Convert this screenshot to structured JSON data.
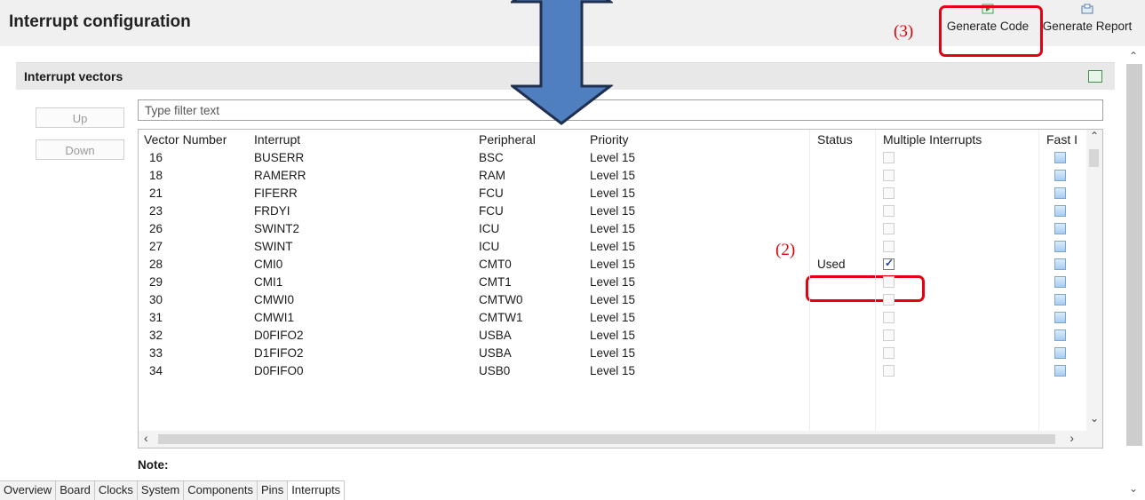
{
  "header": {
    "title": "Interrupt configuration",
    "generate_code": "Generate Code",
    "generate_report": "Generate Report"
  },
  "annotations": {
    "a3": "(3)",
    "a2": "(2)"
  },
  "section": {
    "title": "Interrupt vectors"
  },
  "buttons": {
    "up": "Up",
    "down": "Down"
  },
  "filter": {
    "placeholder": "Type filter text",
    "value": ""
  },
  "table": {
    "columns": [
      "Vector Number",
      "Interrupt",
      "Peripheral",
      "Priority",
      "Status",
      "Multiple Interrupts",
      "Fast I"
    ],
    "rows": [
      {
        "vector": "16",
        "interrupt": "BUSERR",
        "peripheral": "BSC",
        "priority": "Level 15",
        "status": "",
        "multiple": false
      },
      {
        "vector": "18",
        "interrupt": "RAMERR",
        "peripheral": "RAM",
        "priority": "Level 15",
        "status": "",
        "multiple": false
      },
      {
        "vector": "21",
        "interrupt": "FIFERR",
        "peripheral": "FCU",
        "priority": "Level 15",
        "status": "",
        "multiple": false
      },
      {
        "vector": "23",
        "interrupt": "FRDYI",
        "peripheral": "FCU",
        "priority": "Level 15",
        "status": "",
        "multiple": false
      },
      {
        "vector": "26",
        "interrupt": "SWINT2",
        "peripheral": "ICU",
        "priority": "Level 15",
        "status": "",
        "multiple": false
      },
      {
        "vector": "27",
        "interrupt": "SWINT",
        "peripheral": "ICU",
        "priority": "Level 15",
        "status": "",
        "multiple": false
      },
      {
        "vector": "28",
        "interrupt": "CMI0",
        "peripheral": "CMT0",
        "priority": "Level 15",
        "status": "Used",
        "multiple": true
      },
      {
        "vector": "29",
        "interrupt": "CMI1",
        "peripheral": "CMT1",
        "priority": "Level 15",
        "status": "",
        "multiple": false
      },
      {
        "vector": "30",
        "interrupt": "CMWI0",
        "peripheral": "CMTW0",
        "priority": "Level 15",
        "status": "",
        "multiple": false
      },
      {
        "vector": "31",
        "interrupt": "CMWI1",
        "peripheral": "CMTW1",
        "priority": "Level 15",
        "status": "",
        "multiple": false
      },
      {
        "vector": "32",
        "interrupt": "D0FIFO2",
        "peripheral": "USBA",
        "priority": "Level 15",
        "status": "",
        "multiple": false
      },
      {
        "vector": "33",
        "interrupt": "D1FIFO2",
        "peripheral": "USBA",
        "priority": "Level 15",
        "status": "",
        "multiple": false
      },
      {
        "vector": "34",
        "interrupt": "D0FIFO0",
        "peripheral": "USB0",
        "priority": "Level 15",
        "status": "",
        "multiple": false
      }
    ]
  },
  "note": {
    "label": "Note:"
  },
  "tabs": [
    "Overview",
    "Board",
    "Clocks",
    "System",
    "Components",
    "Pins",
    "Interrupts"
  ],
  "active_tab": "Interrupts",
  "colors": {
    "annotation_red": "#e60012",
    "arrow_blue": "#4f7fbf",
    "arrow_outline": "#1f2f4f"
  },
  "icons": {
    "generate_code": "generate-code-icon",
    "generate_report": "generate-report-icon",
    "section": "chart-icon",
    "arrow": "double-arrow-icon"
  }
}
